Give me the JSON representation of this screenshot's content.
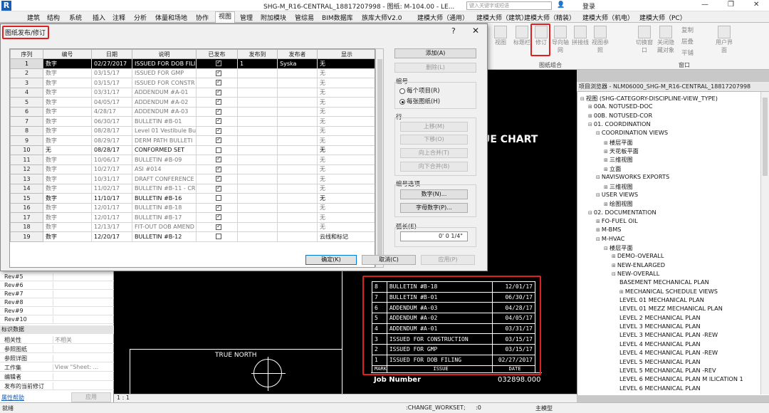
{
  "app": {
    "logo": "R",
    "window_title": "SHG-M_R16-CENTRAL_18817207998 - 图纸: M-104.00 - LE...",
    "search_placeholder": "键入关键字或短语",
    "login": "登录",
    "win_min": "—",
    "win_max": "❐",
    "win_close": "✕"
  },
  "tabs": [
    "建筑",
    "结构",
    "系统",
    "插入",
    "注释",
    "分析",
    "体量和场地",
    "协作",
    "视图",
    "管理",
    "附加模块",
    "管综易",
    "BIM数据库",
    "族库大师V2.0",
    "建模大师（通用）",
    "建模大师（建筑）",
    "建模大师（精装）",
    "建模大师（机电）",
    "建模大师（PC）"
  ],
  "active_tab": "视图",
  "ribbon": {
    "buttons": [
      "视图",
      "标题栏",
      "修订",
      "导向轴网",
      "拼接线",
      "视图参照",
      "切换窗口",
      "关闭隐藏对象",
      "复制",
      "层叠",
      "平铺",
      "用户界面"
    ],
    "groups": [
      "图纸组合",
      "窗口"
    ]
  },
  "dialog": {
    "title": "图纸发布/修订",
    "help": "?",
    "close": "✕",
    "columns": [
      "序列",
      "编号",
      "日期",
      "说明",
      "已发布",
      "发布到",
      "发布者",
      "显示"
    ],
    "rows": [
      {
        "seq": "1",
        "num": "数字",
        "date": "02/27/2017",
        "desc": "ISSUED FOR DOB FILI",
        "issued": true,
        "to": "1",
        "by": "Syska",
        "show": "无",
        "state": "sel"
      },
      {
        "seq": "2",
        "num": "数字",
        "date": "03/15/17",
        "desc": "ISSUED FOR GMP",
        "issued": true,
        "to": "",
        "by": "",
        "show": "无",
        "state": "grey"
      },
      {
        "seq": "3",
        "num": "数字",
        "date": "03/15/17",
        "desc": "ISSUED FOR CONSTR",
        "issued": true,
        "to": "",
        "by": "",
        "show": "无",
        "state": "grey"
      },
      {
        "seq": "4",
        "num": "数字",
        "date": "03/31/17",
        "desc": "ADDENDUM #A-01",
        "issued": true,
        "to": "",
        "by": "",
        "show": "无",
        "state": "grey"
      },
      {
        "seq": "5",
        "num": "数字",
        "date": "04/05/17",
        "desc": "ADDENDUM #A-02",
        "issued": true,
        "to": "",
        "by": "",
        "show": "无",
        "state": "grey"
      },
      {
        "seq": "6",
        "num": "数字",
        "date": "4/28/17",
        "desc": "ADDENDUM #A-03",
        "issued": true,
        "to": "",
        "by": "",
        "show": "无",
        "state": "grey"
      },
      {
        "seq": "7",
        "num": "数字",
        "date": "06/30/17",
        "desc": "BULLETIN #B-01",
        "issued": true,
        "to": "",
        "by": "",
        "show": "无",
        "state": "grey"
      },
      {
        "seq": "8",
        "num": "数字",
        "date": "08/28/17",
        "desc": "Level 01 Vestibule Bul",
        "issued": true,
        "to": "",
        "by": "",
        "show": "无",
        "state": "grey"
      },
      {
        "seq": "9",
        "num": "数字",
        "date": "08/29/17",
        "desc": "DERM PATH BULLETI",
        "issued": true,
        "to": "",
        "by": "",
        "show": "无",
        "state": "grey"
      },
      {
        "seq": "10",
        "num": "无",
        "date": "08/28/17",
        "desc": "CONFORMED SET",
        "issued": false,
        "to": "",
        "by": "",
        "show": "无",
        "state": "dark"
      },
      {
        "seq": "11",
        "num": "数字",
        "date": "10/06/17",
        "desc": "BULLETIN #B-09",
        "issued": true,
        "to": "",
        "by": "",
        "show": "无",
        "state": "grey"
      },
      {
        "seq": "12",
        "num": "数字",
        "date": "10/27/17",
        "desc": "ASI #014",
        "issued": true,
        "to": "",
        "by": "",
        "show": "无",
        "state": "grey"
      },
      {
        "seq": "13",
        "num": "数字",
        "date": "10/31/17",
        "desc": "DRAFT CONFERENCE",
        "issued": true,
        "to": "",
        "by": "",
        "show": "无",
        "state": "grey"
      },
      {
        "seq": "14",
        "num": "数字",
        "date": "11/02/17",
        "desc": "BULLETIN #B-11 - CR",
        "issued": true,
        "to": "",
        "by": "",
        "show": "无",
        "state": "grey"
      },
      {
        "seq": "15",
        "num": "数字",
        "date": "11/10/17",
        "desc": "BULLETIN #B-16",
        "issued": false,
        "to": "",
        "by": "",
        "show": "无",
        "state": "dark"
      },
      {
        "seq": "16",
        "num": "数字",
        "date": "12/01/17",
        "desc": "BULLETIN #B-18",
        "issued": true,
        "to": "",
        "by": "",
        "show": "无",
        "state": "grey"
      },
      {
        "seq": "17",
        "num": "数字",
        "date": "12/01/17",
        "desc": "BULLETIN #B-17",
        "issued": true,
        "to": "",
        "by": "",
        "show": "无",
        "state": "grey"
      },
      {
        "seq": "18",
        "num": "数字",
        "date": "12/13/17",
        "desc": "FIT-OUT DOB AMEND",
        "issued": true,
        "to": "",
        "by": "",
        "show": "无",
        "state": "grey"
      },
      {
        "seq": "19",
        "num": "数字",
        "date": "12/20/17",
        "desc": "BULLETIN #B-12",
        "issued": false,
        "to": "",
        "by": "",
        "show": "云线和标记",
        "state": "dark"
      }
    ],
    "add": "添加(A)",
    "delete": "删除(L)",
    "numbering_label": "编号",
    "per_project": "每个项目(R)",
    "per_sheet": "每张图纸(H)",
    "row_label": "行",
    "move_up": "上移(M)",
    "move_down": "下移(O)",
    "merge_up": "向上合并(T)",
    "merge_down": "向下合并(B)",
    "options_label": "编号选项",
    "numeric": "数字(N)...",
    "alphanumeric": "字母数字(P)...",
    "arc_label": "弧长(E)",
    "arc_value": "0'   0 1/4\"",
    "ok": "确定(K)",
    "cancel": "取消(C)",
    "apply": "应用(P)"
  },
  "properties": {
    "rev_rows": [
      "Rev#5",
      "Rev#6",
      "Rev#7",
      "Rev#8",
      "Rev#9",
      "Rev#10"
    ],
    "section": "标识数据",
    "fields": [
      {
        "k": "相关性",
        "v": "不相关"
      },
      {
        "k": "参照图纸",
        "v": ""
      },
      {
        "k": "参照详图",
        "v": ""
      },
      {
        "k": "工作集",
        "v": "View \"Sheet: ..."
      },
      {
        "k": "编辑者",
        "v": ""
      },
      {
        "k": "发布的当前修订",
        "v": ""
      }
    ],
    "help_link": "属性帮助",
    "apply": "应用"
  },
  "canvas": {
    "chart_title": "UE CHART",
    "true_north": "TRUE NORTH",
    "job_label": "Job Number",
    "job_value": "032898.000",
    "revisions": [
      {
        "mark": "8",
        "issue": "BULLETIN #B-18",
        "date": "12/01/17"
      },
      {
        "mark": "7",
        "issue": "BULLETIN #B-01",
        "date": "06/30/17"
      },
      {
        "mark": "6",
        "issue": "ADDENDUM #A-03",
        "date": "04/28/17"
      },
      {
        "mark": "5",
        "issue": "ADDENDUM #A-02",
        "date": "04/05/17"
      },
      {
        "mark": "4",
        "issue": "ADDENDUM #A-01",
        "date": "03/31/17"
      },
      {
        "mark": "3",
        "issue": "ISSUED FOR CONSTRUCTION",
        "date": "03/15/17"
      },
      {
        "mark": "2",
        "issue": "ISSUED FOR GMP",
        "date": "03/15/17"
      },
      {
        "mark": "1",
        "issue": "ISSUED FOR DOB FILING",
        "date": "02/27/2017"
      }
    ],
    "rev_headers": [
      "MARK",
      "ISSUE",
      "DATE"
    ],
    "view_scale": "1 : 1"
  },
  "browser": {
    "title": "项目浏览器 - NLM06000_SHG-M_R16-CENTRAL_18817207998",
    "nodes": [
      {
        "t": "视图 (SHG-CATEGORY-DISCIPLINE-VIEW_TYPE)",
        "lvl": 0,
        "tog": "⊟"
      },
      {
        "t": "00A. NOTUSED-DOC",
        "lvl": 1,
        "tog": "⊞"
      },
      {
        "t": "00B. NOTUSED-COR",
        "lvl": 1,
        "tog": "⊞"
      },
      {
        "t": "01. COORDINATION",
        "lvl": 1,
        "tog": "⊟"
      },
      {
        "t": "COORDINATION VIEWS",
        "lvl": 2,
        "tog": "⊟"
      },
      {
        "t": "楼层平面",
        "lvl": 3,
        "tog": "⊞"
      },
      {
        "t": "天花板平面",
        "lvl": 3,
        "tog": "⊞"
      },
      {
        "t": "三维视图",
        "lvl": 3,
        "tog": "⊞"
      },
      {
        "t": "立面",
        "lvl": 3,
        "tog": "⊞"
      },
      {
        "t": "NAVISWORKS EXPORTS",
        "lvl": 2,
        "tog": "⊟"
      },
      {
        "t": "三维视图",
        "lvl": 3,
        "tog": "⊞"
      },
      {
        "t": "USER VIEWS",
        "lvl": 2,
        "tog": "⊟"
      },
      {
        "t": "绘图视图",
        "lvl": 3,
        "tog": "⊞"
      },
      {
        "t": "02. DOCUMENTATION",
        "lvl": 1,
        "tog": "⊟"
      },
      {
        "t": "FO-FUEL OIL",
        "lvl": 2,
        "tog": "⊞"
      },
      {
        "t": "M-BMS",
        "lvl": 2,
        "tog": "⊞"
      },
      {
        "t": "M-HVAC",
        "lvl": 2,
        "tog": "⊟"
      },
      {
        "t": "楼层平面",
        "lvl": 3,
        "tog": "⊟"
      },
      {
        "t": "DEMO-OVERALL",
        "lvl": 4,
        "tog": "⊞"
      },
      {
        "t": "NEW-ENLARGED",
        "lvl": 4,
        "tog": "⊞"
      },
      {
        "t": "NEW-OVERALL",
        "lvl": 4,
        "tog": "⊟"
      },
      {
        "t": "BASEMENT MECHANICAL PLAN",
        "lvl": 5,
        "tog": ""
      },
      {
        "t": "MECHANICAL SCHEDULE VIEWS",
        "lvl": 5,
        "tog": "⊞"
      },
      {
        "t": "LEVEL 01 MECHANICAL PLAN",
        "lvl": 5,
        "tog": ""
      },
      {
        "t": "LEVEL 01 MEZZ MECHANICAL PLAN",
        "lvl": 5,
        "tog": ""
      },
      {
        "t": "LEVEL 2 MECHANICAL PLAN",
        "lvl": 5,
        "tog": ""
      },
      {
        "t": "LEVEL 3 MECHANICAL PLAN",
        "lvl": 5,
        "tog": ""
      },
      {
        "t": "LEVEL 3 MECHANICAL PLAN -REW",
        "lvl": 5,
        "tog": ""
      },
      {
        "t": "LEVEL 4 MECHANICAL PLAN",
        "lvl": 5,
        "tog": ""
      },
      {
        "t": "LEVEL 4 MECHANICAL PLAN -REW",
        "lvl": 5,
        "tog": ""
      },
      {
        "t": "LEVEL 5 MECHANICAL PLAN",
        "lvl": 5,
        "tog": ""
      },
      {
        "t": "LEVEL 5 MECHANICAL PLAN -REV",
        "lvl": 5,
        "tog": ""
      },
      {
        "t": "LEVEL 6 MECHANICAL PLAN M ILICATION 1",
        "lvl": 5,
        "tog": ""
      },
      {
        "t": "LEVEL 6 MECHANICAL PLAN",
        "lvl": 5,
        "tog": ""
      }
    ]
  },
  "status": {
    "ready": "就绪",
    "workset": ":CHANGE_WORKSET;",
    "model": "主模型",
    "zero": ":0"
  }
}
